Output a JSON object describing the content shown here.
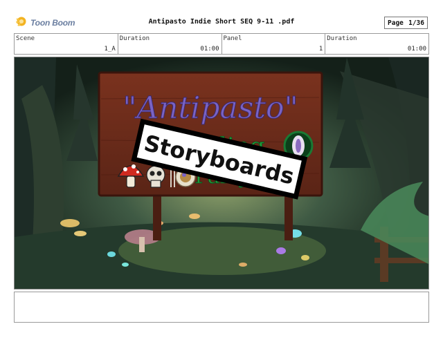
{
  "app": {
    "logo_text": "Toon Boom"
  },
  "document": {
    "title": "Antipasto Indie Short SEQ 9-11 .pdf"
  },
  "page": {
    "label": "Page",
    "value": "1/36"
  },
  "info": {
    "scene_label": "Scene",
    "scene_value": "1_A",
    "duration1_label": "Duration",
    "duration1_value": "01:00",
    "panel_label": "Panel",
    "panel_value": "1",
    "duration2_label": "Duration",
    "duration2_value": "01:00"
  },
  "artwork": {
    "sign_title": "\"Antipasto\"",
    "sign_line2": "Crawling",
    "sign_line3": "Party",
    "banner_text": "Storyboards"
  },
  "notes": {
    "text": ""
  },
  "colors": {
    "sign_wood": "#6b2a1a",
    "title_purple": "#7a63c4",
    "subtitle_green": "#1f9a3a",
    "forest_dark": "#1b2a24"
  }
}
